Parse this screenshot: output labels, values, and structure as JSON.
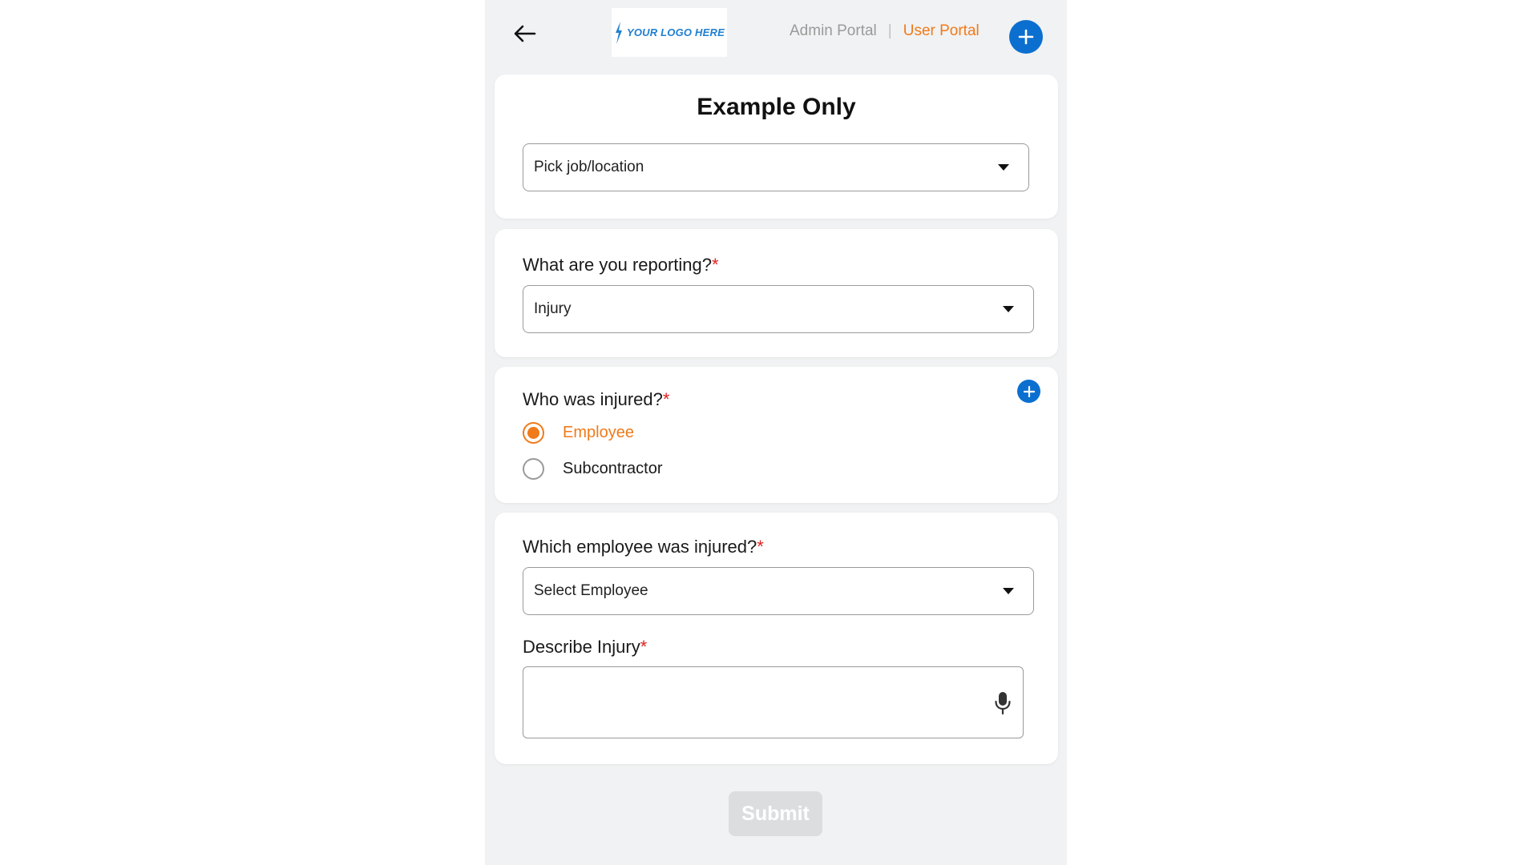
{
  "header": {
    "logo_text": "YOUR LOGO HERE",
    "portal_admin": "Admin Portal",
    "portal_separator": "|",
    "portal_user": "User Portal",
    "active_portal": "User Portal"
  },
  "form": {
    "title": "Example Only",
    "job_location": {
      "value": "Pick job/location"
    },
    "reporting": {
      "label": "What are you reporting?",
      "required_mark": "*",
      "value": "Injury"
    },
    "who_injured": {
      "label": "Who was injured?",
      "required_mark": "*",
      "options": [
        "Employee",
        "Subcontractor"
      ],
      "selected": "Employee"
    },
    "which_employee": {
      "label": "Which employee was injured?",
      "required_mark": "*",
      "value": "Select Employee"
    },
    "describe_injury": {
      "label": "Describe Injury",
      "required_mark": "*",
      "value": ""
    },
    "submit_label": "Submit",
    "submit_enabled": false
  },
  "colors": {
    "accent_orange": "#f07a1a",
    "primary_blue": "#0b6fd0",
    "required_red": "#e02020",
    "background": "#f1f2f3"
  },
  "icons": {
    "back": "arrow-left-icon",
    "add": "plus-icon",
    "mic": "microphone-icon",
    "dropdown": "caret-down-icon"
  }
}
